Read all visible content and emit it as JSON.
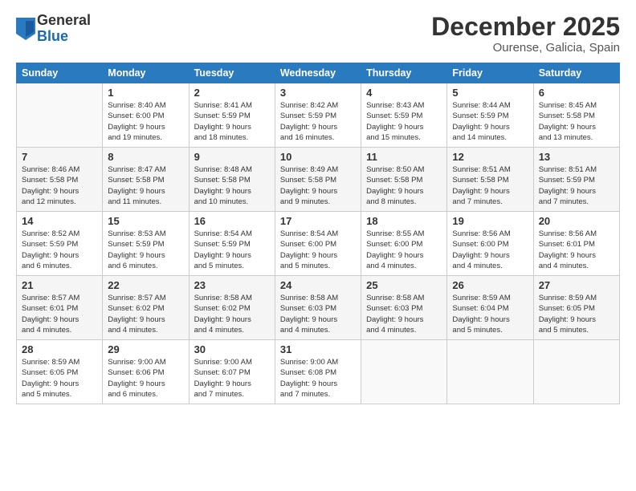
{
  "logo": {
    "general": "General",
    "blue": "Blue"
  },
  "title": "December 2025",
  "subtitle": "Ourense, Galicia, Spain",
  "days_of_week": [
    "Sunday",
    "Monday",
    "Tuesday",
    "Wednesday",
    "Thursday",
    "Friday",
    "Saturday"
  ],
  "weeks": [
    [
      {
        "day": "",
        "info": ""
      },
      {
        "day": "1",
        "info": "Sunrise: 8:40 AM\nSunset: 6:00 PM\nDaylight: 9 hours\nand 19 minutes."
      },
      {
        "day": "2",
        "info": "Sunrise: 8:41 AM\nSunset: 5:59 PM\nDaylight: 9 hours\nand 18 minutes."
      },
      {
        "day": "3",
        "info": "Sunrise: 8:42 AM\nSunset: 5:59 PM\nDaylight: 9 hours\nand 16 minutes."
      },
      {
        "day": "4",
        "info": "Sunrise: 8:43 AM\nSunset: 5:59 PM\nDaylight: 9 hours\nand 15 minutes."
      },
      {
        "day": "5",
        "info": "Sunrise: 8:44 AM\nSunset: 5:59 PM\nDaylight: 9 hours\nand 14 minutes."
      },
      {
        "day": "6",
        "info": "Sunrise: 8:45 AM\nSunset: 5:58 PM\nDaylight: 9 hours\nand 13 minutes."
      }
    ],
    [
      {
        "day": "7",
        "info": "Sunrise: 8:46 AM\nSunset: 5:58 PM\nDaylight: 9 hours\nand 12 minutes."
      },
      {
        "day": "8",
        "info": "Sunrise: 8:47 AM\nSunset: 5:58 PM\nDaylight: 9 hours\nand 11 minutes."
      },
      {
        "day": "9",
        "info": "Sunrise: 8:48 AM\nSunset: 5:58 PM\nDaylight: 9 hours\nand 10 minutes."
      },
      {
        "day": "10",
        "info": "Sunrise: 8:49 AM\nSunset: 5:58 PM\nDaylight: 9 hours\nand 9 minutes."
      },
      {
        "day": "11",
        "info": "Sunrise: 8:50 AM\nSunset: 5:58 PM\nDaylight: 9 hours\nand 8 minutes."
      },
      {
        "day": "12",
        "info": "Sunrise: 8:51 AM\nSunset: 5:58 PM\nDaylight: 9 hours\nand 7 minutes."
      },
      {
        "day": "13",
        "info": "Sunrise: 8:51 AM\nSunset: 5:59 PM\nDaylight: 9 hours\nand 7 minutes."
      }
    ],
    [
      {
        "day": "14",
        "info": "Sunrise: 8:52 AM\nSunset: 5:59 PM\nDaylight: 9 hours\nand 6 minutes."
      },
      {
        "day": "15",
        "info": "Sunrise: 8:53 AM\nSunset: 5:59 PM\nDaylight: 9 hours\nand 6 minutes."
      },
      {
        "day": "16",
        "info": "Sunrise: 8:54 AM\nSunset: 5:59 PM\nDaylight: 9 hours\nand 5 minutes."
      },
      {
        "day": "17",
        "info": "Sunrise: 8:54 AM\nSunset: 6:00 PM\nDaylight: 9 hours\nand 5 minutes."
      },
      {
        "day": "18",
        "info": "Sunrise: 8:55 AM\nSunset: 6:00 PM\nDaylight: 9 hours\nand 4 minutes."
      },
      {
        "day": "19",
        "info": "Sunrise: 8:56 AM\nSunset: 6:00 PM\nDaylight: 9 hours\nand 4 minutes."
      },
      {
        "day": "20",
        "info": "Sunrise: 8:56 AM\nSunset: 6:01 PM\nDaylight: 9 hours\nand 4 minutes."
      }
    ],
    [
      {
        "day": "21",
        "info": "Sunrise: 8:57 AM\nSunset: 6:01 PM\nDaylight: 9 hours\nand 4 minutes."
      },
      {
        "day": "22",
        "info": "Sunrise: 8:57 AM\nSunset: 6:02 PM\nDaylight: 9 hours\nand 4 minutes."
      },
      {
        "day": "23",
        "info": "Sunrise: 8:58 AM\nSunset: 6:02 PM\nDaylight: 9 hours\nand 4 minutes."
      },
      {
        "day": "24",
        "info": "Sunrise: 8:58 AM\nSunset: 6:03 PM\nDaylight: 9 hours\nand 4 minutes."
      },
      {
        "day": "25",
        "info": "Sunrise: 8:58 AM\nSunset: 6:03 PM\nDaylight: 9 hours\nand 4 minutes."
      },
      {
        "day": "26",
        "info": "Sunrise: 8:59 AM\nSunset: 6:04 PM\nDaylight: 9 hours\nand 5 minutes."
      },
      {
        "day": "27",
        "info": "Sunrise: 8:59 AM\nSunset: 6:05 PM\nDaylight: 9 hours\nand 5 minutes."
      }
    ],
    [
      {
        "day": "28",
        "info": "Sunrise: 8:59 AM\nSunset: 6:05 PM\nDaylight: 9 hours\nand 5 minutes."
      },
      {
        "day": "29",
        "info": "Sunrise: 9:00 AM\nSunset: 6:06 PM\nDaylight: 9 hours\nand 6 minutes."
      },
      {
        "day": "30",
        "info": "Sunrise: 9:00 AM\nSunset: 6:07 PM\nDaylight: 9 hours\nand 7 minutes."
      },
      {
        "day": "31",
        "info": "Sunrise: 9:00 AM\nSunset: 6:08 PM\nDaylight: 9 hours\nand 7 minutes."
      },
      {
        "day": "",
        "info": ""
      },
      {
        "day": "",
        "info": ""
      },
      {
        "day": "",
        "info": ""
      }
    ]
  ]
}
